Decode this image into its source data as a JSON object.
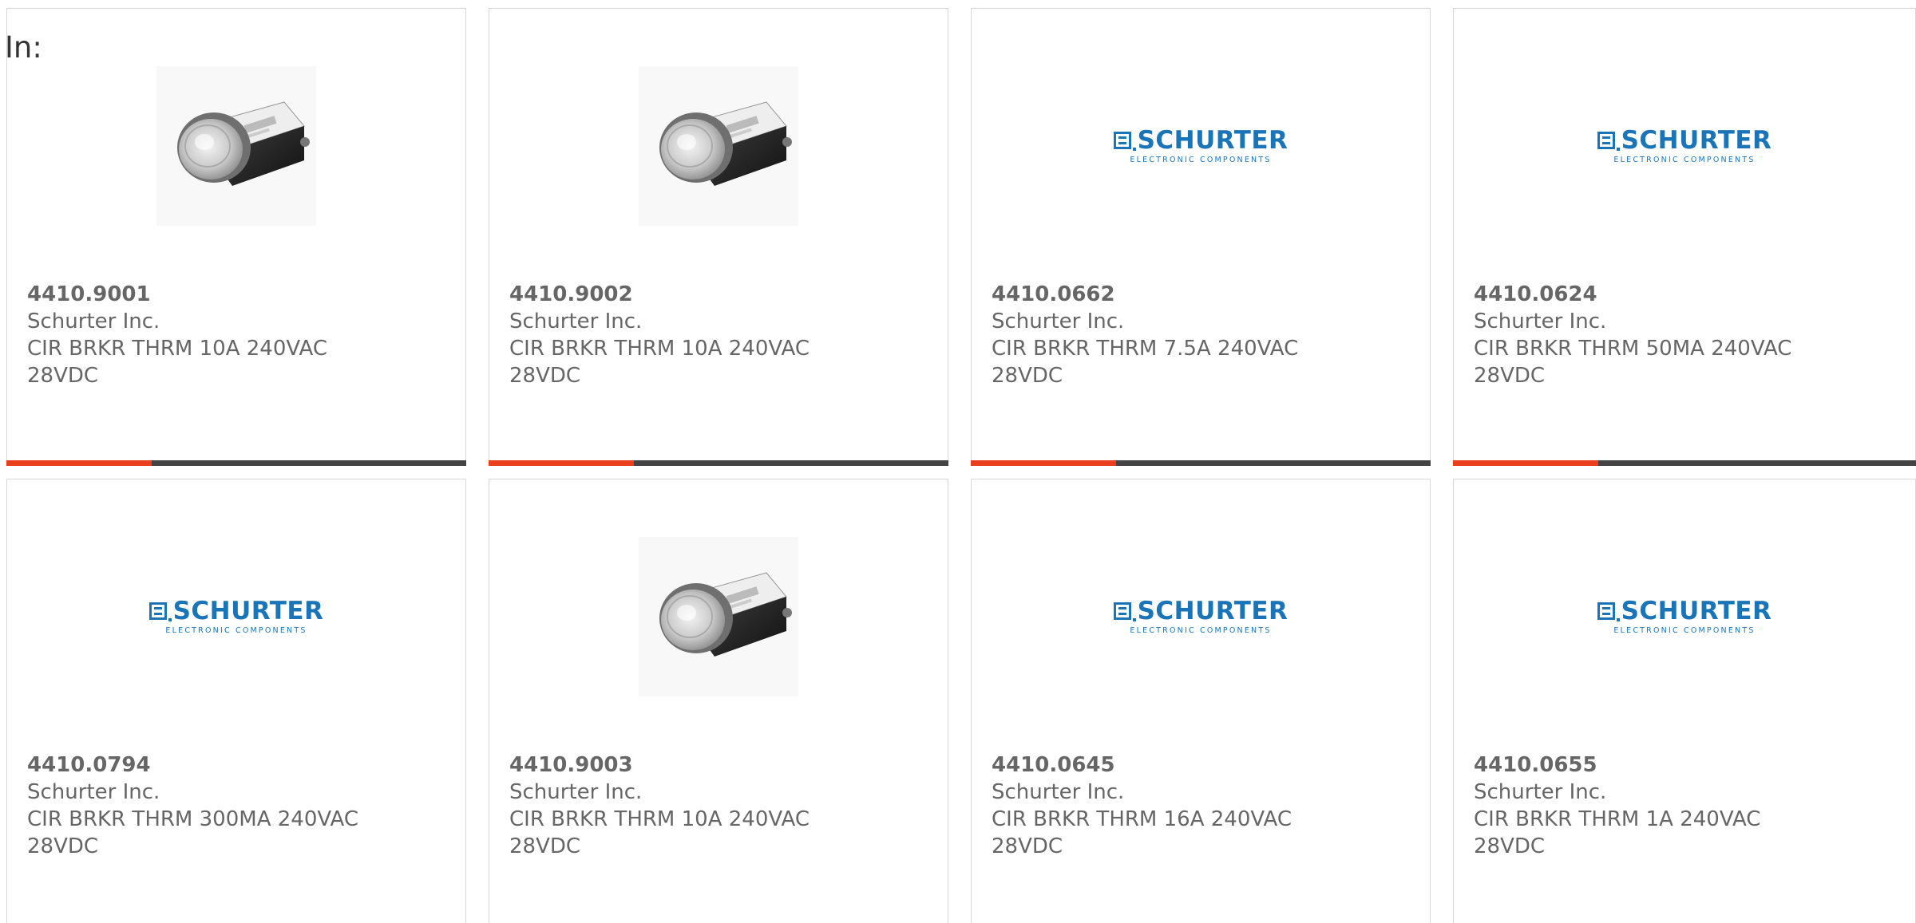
{
  "header": {
    "in_label": "In:"
  },
  "colors": {
    "accent": "#e8401c",
    "bar": "#444444",
    "logo_blue": "#1a74b8",
    "text": "#666666"
  },
  "products": [
    {
      "part_number": "4410.9001",
      "manufacturer": "Schurter Inc.",
      "description_line1": "CIR BRKR THRM 10A 240VAC",
      "description_line2": "28VDC",
      "image": "product-photo"
    },
    {
      "part_number": "4410.9002",
      "manufacturer": "Schurter Inc.",
      "description_line1": "CIR BRKR THRM 10A 240VAC",
      "description_line2": "28VDC",
      "image": "product-photo"
    },
    {
      "part_number": "4410.0662",
      "manufacturer": "Schurter Inc.",
      "description_line1": "CIR BRKR THRM 7.5A 240VAC",
      "description_line2": "28VDC",
      "image": "schurter-logo",
      "logo_text": "SCHURTER",
      "logo_subtext": "ELECTRONIC COMPONENTS"
    },
    {
      "part_number": "4410.0624",
      "manufacturer": "Schurter Inc.",
      "description_line1": "CIR BRKR THRM 50MA 240VAC",
      "description_line2": "28VDC",
      "image": "schurter-logo",
      "logo_text": "SCHURTER",
      "logo_subtext": "ELECTRONIC COMPONENTS"
    },
    {
      "part_number": "4410.0794",
      "manufacturer": "Schurter Inc.",
      "description_line1": "CIR BRKR THRM 300MA 240VAC",
      "description_line2": "28VDC",
      "image": "schurter-logo",
      "logo_text": "SCHURTER",
      "logo_subtext": "ELECTRONIC COMPONENTS"
    },
    {
      "part_number": "4410.9003",
      "manufacturer": "Schurter Inc.",
      "description_line1": "CIR BRKR THRM 10A 240VAC",
      "description_line2": "28VDC",
      "image": "product-photo"
    },
    {
      "part_number": "4410.0645",
      "manufacturer": "Schurter Inc.",
      "description_line1": "CIR BRKR THRM 16A 240VAC",
      "description_line2": "28VDC",
      "image": "schurter-logo",
      "logo_text": "SCHURTER",
      "logo_subtext": "ELECTRONIC COMPONENTS"
    },
    {
      "part_number": "4410.0655",
      "manufacturer": "Schurter Inc.",
      "description_line1": "CIR BRKR THRM 1A 240VAC",
      "description_line2": "28VDC",
      "image": "schurter-logo",
      "logo_text": "SCHURTER",
      "logo_subtext": "ELECTRONIC COMPONENTS"
    }
  ]
}
